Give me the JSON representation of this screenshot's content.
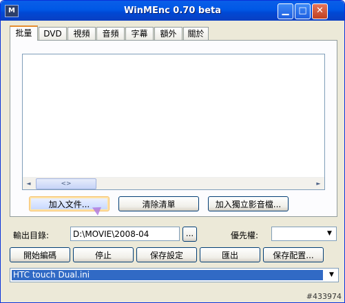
{
  "window": {
    "title": "WinMEnc 0.70 beta",
    "app_icon_text": "M",
    "min_glyph": "▁",
    "max_glyph": "□",
    "close_glyph": "✕"
  },
  "tabs": [
    {
      "label": "批量",
      "active": true
    },
    {
      "label": "DVD"
    },
    {
      "label": "視頻"
    },
    {
      "label": "音頻"
    },
    {
      "label": "字幕"
    },
    {
      "label": "額外"
    },
    {
      "label": "關於"
    }
  ],
  "file_list": {
    "scroll_left": "◄",
    "scroll_right": "►",
    "thumb_grip": "<>"
  },
  "batch_buttons": {
    "add_file": "加入文件...",
    "clear_list": "清除清單",
    "add_audio": "加入獨立影音檔..."
  },
  "output": {
    "label": "輸出目錄:",
    "value": "D:\\MOVIE\\2008-04",
    "browse": "..."
  },
  "priority": {
    "label": "優先權:",
    "value": "",
    "arrow": "▼"
  },
  "actions": {
    "start": "開始編碼",
    "stop": "停止",
    "save_settings": "保存設定",
    "export": "匯出",
    "save_config": "保存配置..."
  },
  "preset": {
    "value": "HTC touch Dual.ini",
    "arrow": "▼"
  },
  "watermark": "#433974",
  "colors": {
    "title_bar": "#0058e6",
    "selection": "#316ac5",
    "face": "#ece9d8",
    "active_tab_accent": "#e68b2c"
  }
}
